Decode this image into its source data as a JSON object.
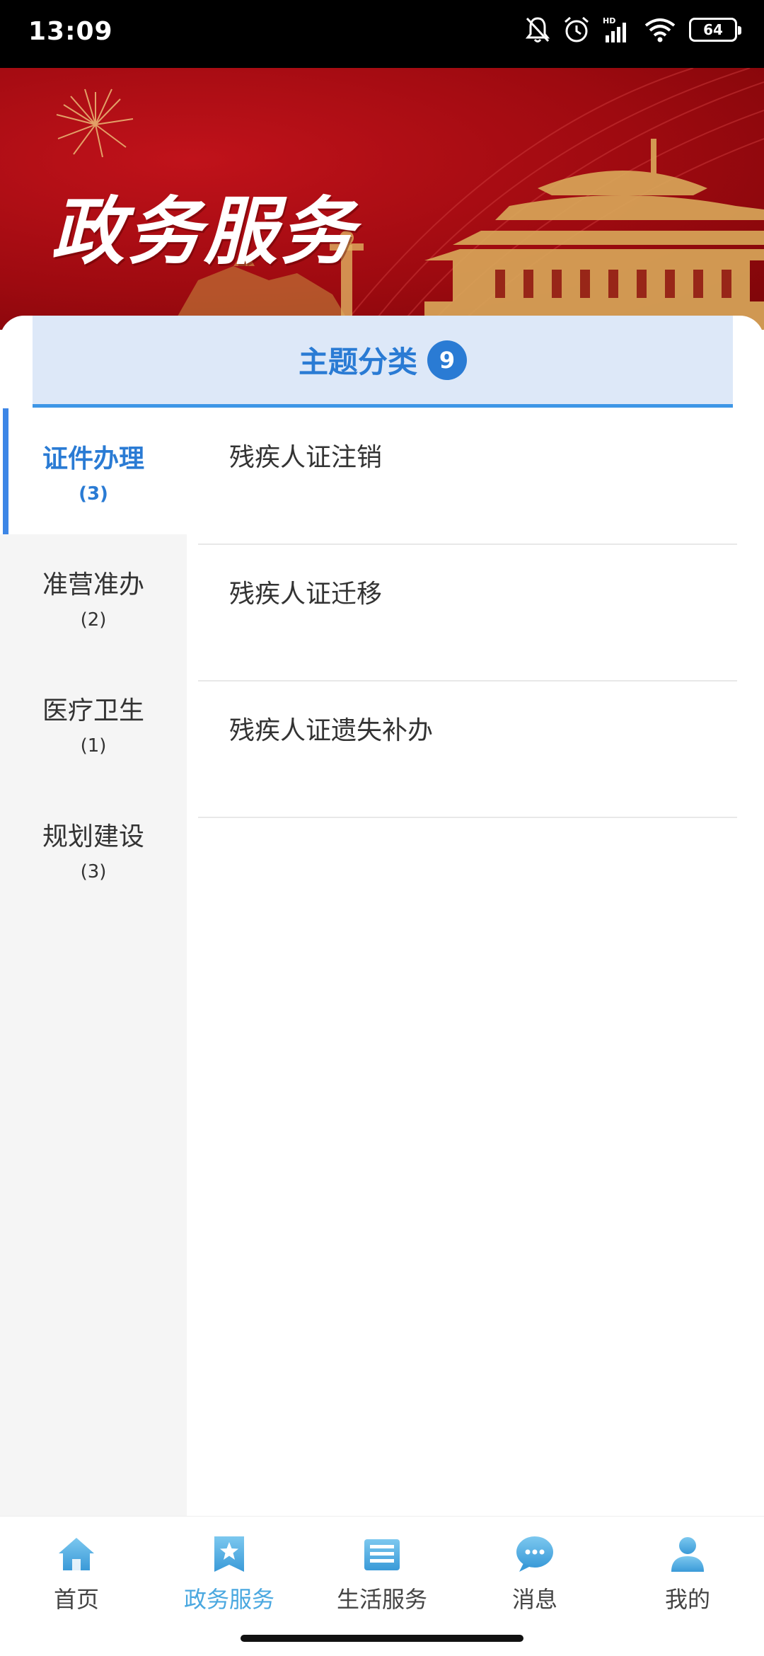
{
  "status_bar": {
    "time": "13:09",
    "battery": "64",
    "icons": [
      "mute-bell-icon",
      "alarm-icon",
      "hd-signal-icon",
      "wifi-icon",
      "battery-icon"
    ]
  },
  "banner": {
    "title": "政务服务"
  },
  "topic_header": {
    "title": "主题分类",
    "count": "9"
  },
  "sidebar": {
    "items": [
      {
        "label": "证件办理",
        "count": "(3)",
        "active": true
      },
      {
        "label": "准营准办",
        "count": "(2)",
        "active": false
      },
      {
        "label": "医疗卫生",
        "count": "(1)",
        "active": false
      },
      {
        "label": "规划建设",
        "count": "(3)",
        "active": false
      }
    ]
  },
  "content": {
    "items": [
      {
        "label": "残疾人证注销"
      },
      {
        "label": "残疾人证迁移"
      },
      {
        "label": "残疾人证遗失补办"
      }
    ]
  },
  "bottom_nav": {
    "items": [
      {
        "label": "首页",
        "icon": "home-icon",
        "active": false
      },
      {
        "label": "政务服务",
        "icon": "star-bookmark-icon",
        "active": true
      },
      {
        "label": "生活服务",
        "icon": "document-icon",
        "active": false
      },
      {
        "label": "消息",
        "icon": "chat-bubble-icon",
        "active": false
      },
      {
        "label": "我的",
        "icon": "person-icon",
        "active": false
      }
    ]
  },
  "colors": {
    "accent": "#2a7bd4",
    "nav_active": "#4aa8e0",
    "banner_red": "#a50c12"
  }
}
